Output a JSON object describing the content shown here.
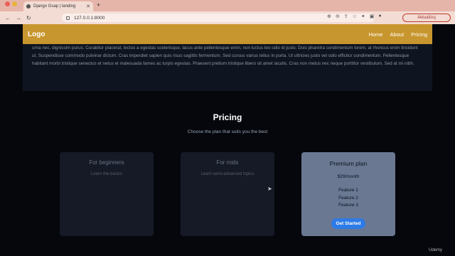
{
  "browser": {
    "tab_title": "Django Gsap | landing",
    "url": "127.0.0.1:8000",
    "update_button": "Aktualizuj"
  },
  "navbar": {
    "logo": "Logo",
    "items": [
      {
        "label": "Home"
      },
      {
        "label": "About"
      },
      {
        "label": "Pricing"
      }
    ]
  },
  "about": {
    "text": "urna nec, dignissim purus. Curabitur placerat, lectus a egestas scelerisque, lacus ante pellentesque enim, non luctus leo odio id justo. Duis pharetra condimentum lorem, at rhoncus enim tincidunt ut. Suspendisse commodo pulvinar dictum. Cras imperdiet sapien quis risus sagittis fermentum. Sed cursus varius tellus in porta. Ut ultricies justo vel odio efficitur condimentum. Pellentesque habitant morbi tristique senectus et netus et malesuada fames ac turpis egestas. Praesent pretium tristique libero sit amet iaculis. Cras non metus nec neque porttitor vestibulum. Sed at mi nibh."
  },
  "pricing": {
    "title": "Pricing",
    "subtitle": "Choose the plan that suits you the best",
    "plans": [
      {
        "title": "For beginners",
        "desc": "Learn the basics"
      },
      {
        "title": "For mids",
        "desc": "Learn semi-advanced topics"
      },
      {
        "title": "Premium plan",
        "price": "$29/month",
        "features": [
          "Feature 1",
          "Feature 2",
          "Feature 3"
        ],
        "button": "Get Started"
      }
    ]
  },
  "watermark": "Udemy"
}
